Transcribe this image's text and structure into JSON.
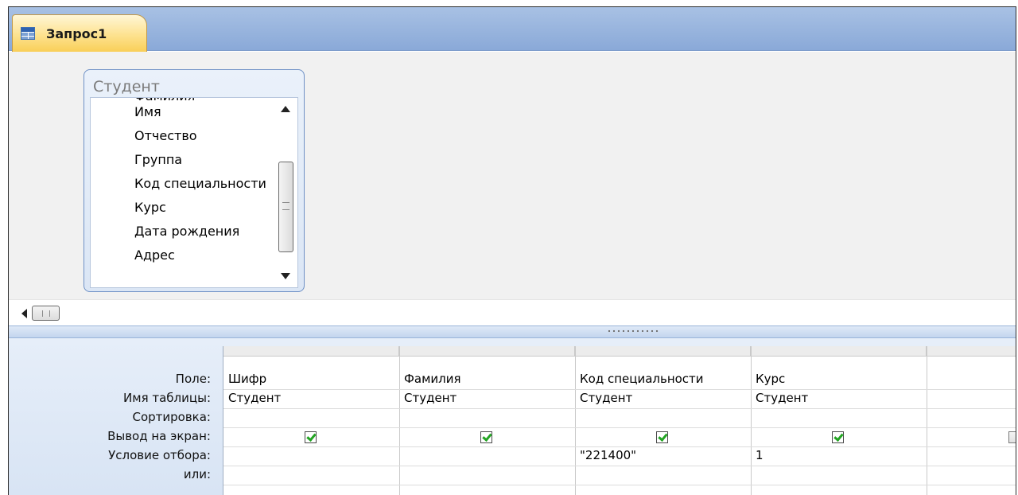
{
  "tab": {
    "label": "Запрос1",
    "icon": "query-table-icon"
  },
  "table_box": {
    "title": "Студент",
    "cut_field": "Фамилия",
    "fields": [
      "Имя",
      "Отчество",
      "Группа",
      "Код специальности",
      "Курс",
      "Дата рождения",
      "Адрес"
    ]
  },
  "grid": {
    "row_labels": {
      "field": "Поле:",
      "table": "Имя таблицы:",
      "sort": "Сортировка:",
      "show": "Вывод на экран:",
      "criteria": "Условие отбора:",
      "or": "или:"
    },
    "columns": [
      {
        "field": "Шифр",
        "table": "Студент",
        "sort": "",
        "show": true,
        "criteria": "",
        "or": ""
      },
      {
        "field": "Фамилия",
        "table": "Студент",
        "sort": "",
        "show": true,
        "criteria": "",
        "or": ""
      },
      {
        "field": "Код специальности",
        "table": "Студент",
        "sort": "",
        "show": true,
        "criteria": "\"221400\"",
        "or": ""
      },
      {
        "field": "Курс",
        "table": "Студент",
        "sort": "",
        "show": true,
        "criteria": "1",
        "or": ""
      },
      {
        "field": "",
        "table": "",
        "sort": "",
        "show": false,
        "criteria": "",
        "or": ""
      }
    ]
  },
  "colors": {
    "tab_accent": "#fde28f",
    "tabbar": "#a8c1e4",
    "checkmark": "#23a423"
  }
}
